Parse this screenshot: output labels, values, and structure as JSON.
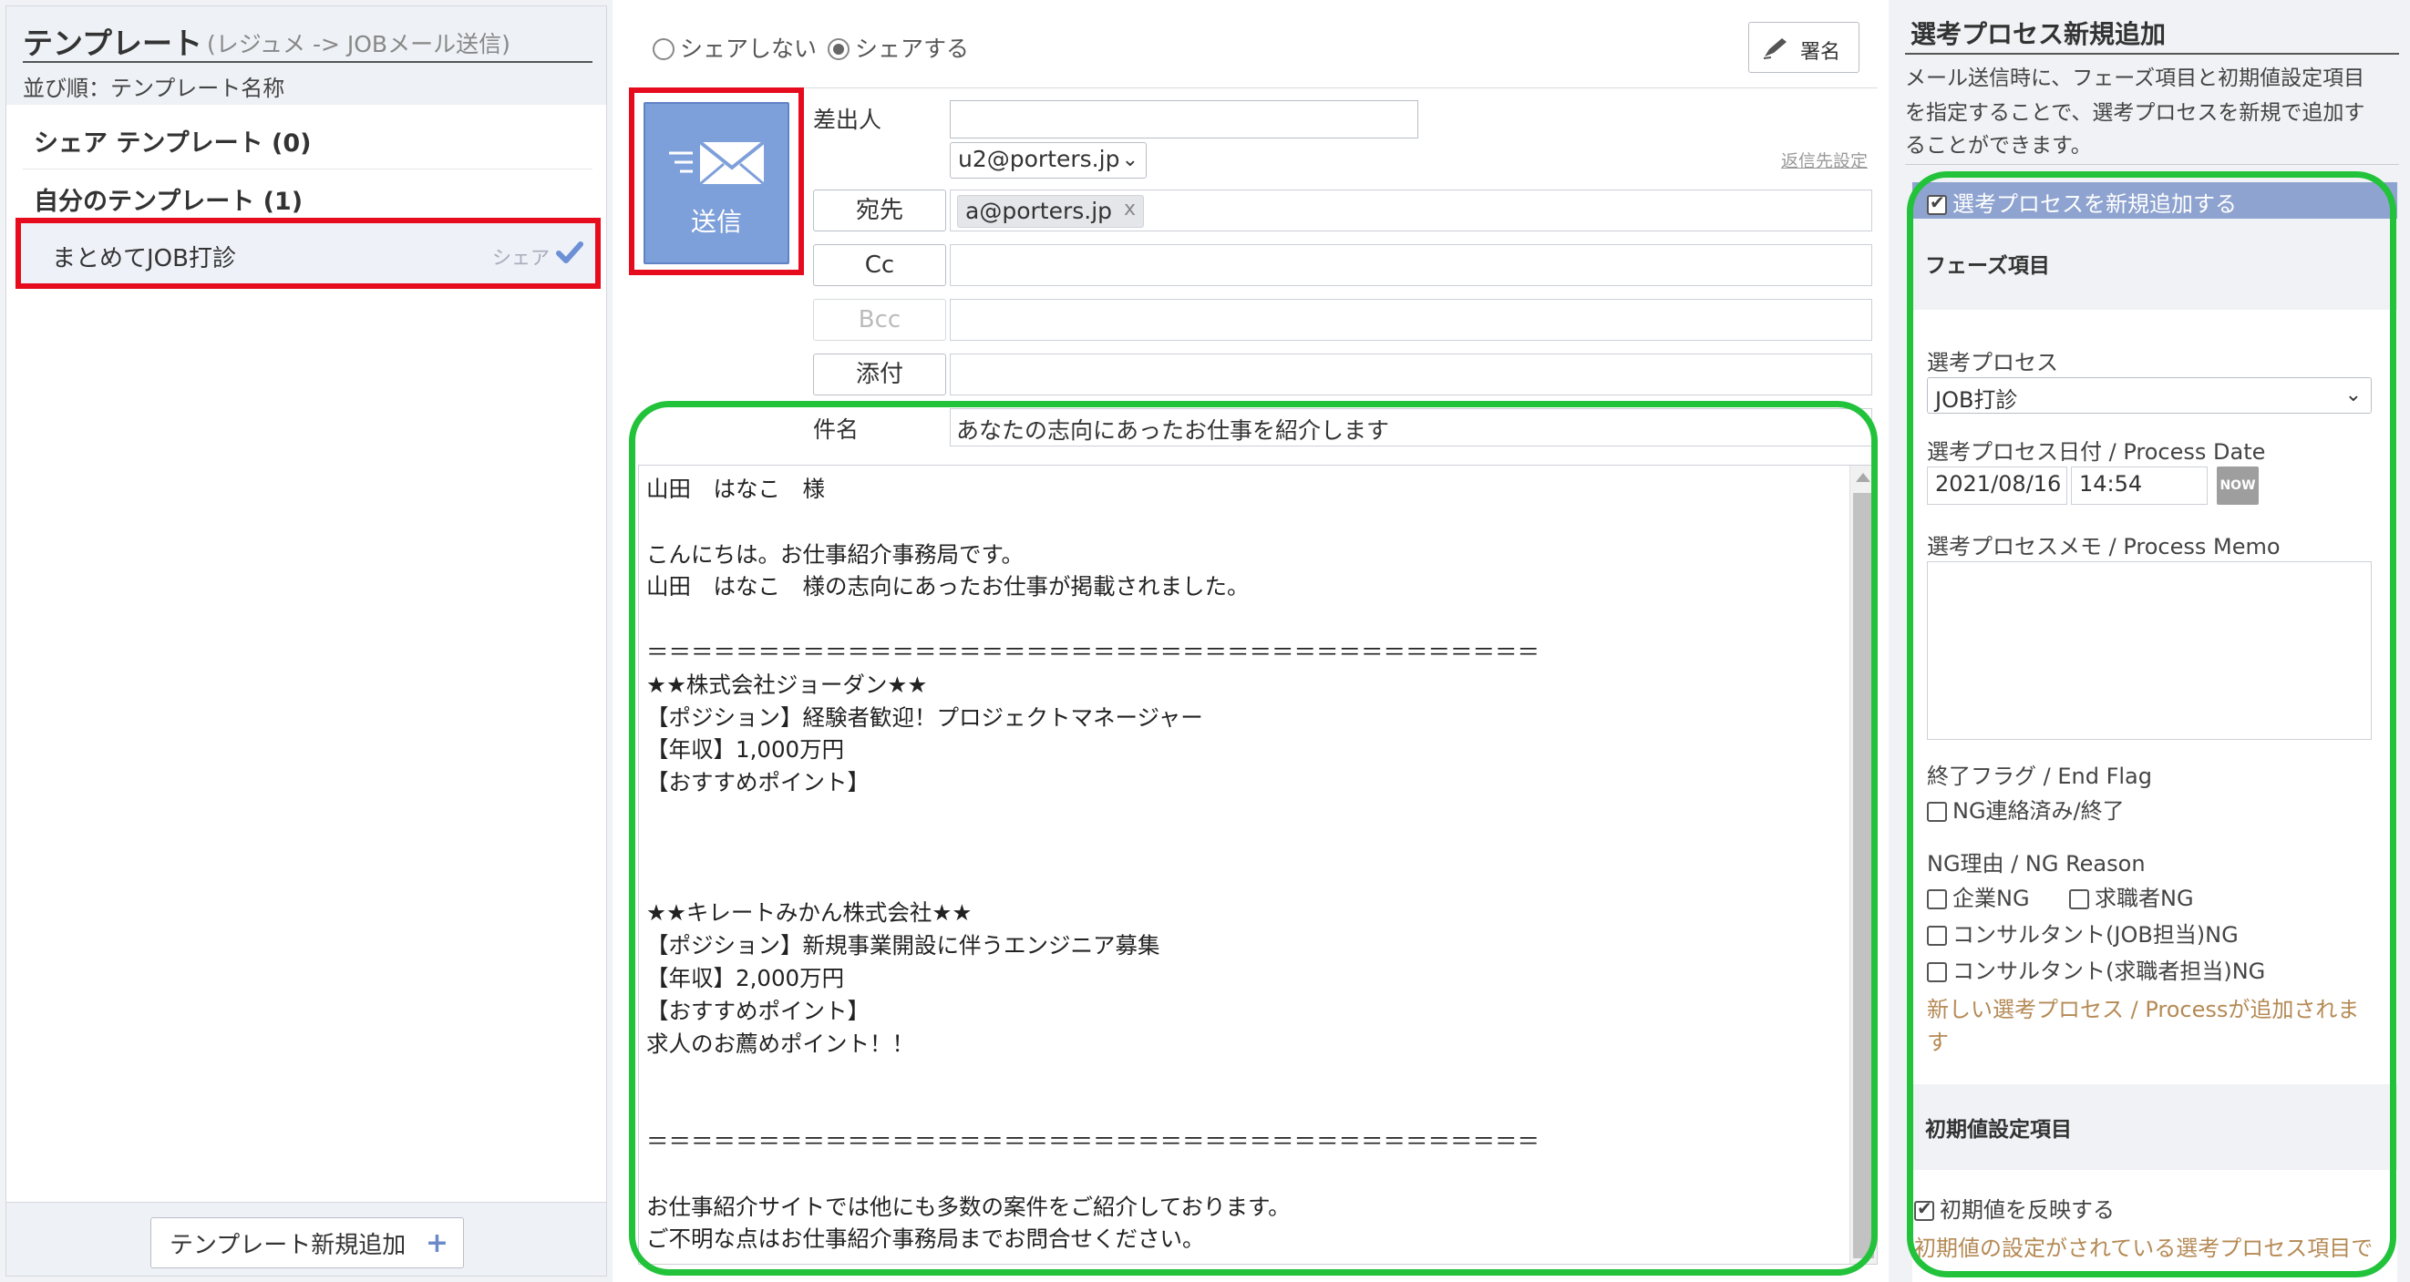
{
  "templates": {
    "title": "テンプレート",
    "subtitle": "(レジュメ -> JOBメール送信)",
    "sort_label": "並び順：テンプレート名称",
    "shared_group": "シェア テンプレート (0)",
    "my_group": "自分のテンプレート (1)",
    "items": [
      {
        "name": "まとめてJOB打診",
        "share_label": "シェア"
      }
    ],
    "add_button": "テンプレート新規追加",
    "add_icon": "+"
  },
  "compose": {
    "share_options": [
      {
        "label": "シェアしない",
        "selected": false
      },
      {
        "label": "シェアする",
        "selected": true
      }
    ],
    "signature_button": "署名",
    "send_button": "送信",
    "from_label": "差出人",
    "from_value": "",
    "from_select": "u2@porters.jp",
    "reply_link": "返信先設定",
    "to_button": "宛先",
    "to_recipient": "a@porters.jp",
    "remove_icon": "x",
    "cc_button": "Cc",
    "bcc_button": "Bcc",
    "attach_button": "添付",
    "subject_label": "件名",
    "subject_value": "あなたの志向にあったお仕事を紹介します",
    "body": "山田　はなこ　様\n\nこんにちは。お仕事紹介事務局です。\n山田　はなこ　様の志向にあったお仕事が掲載されました。\n\n＝＝＝＝＝＝＝＝＝＝＝＝＝＝＝＝＝＝＝＝＝＝＝＝＝＝＝＝＝＝＝＝＝＝＝＝＝＝＝＝\n★★株式会社ジョーダン★★\n【ポジション】経験者歓迎！プロジェクトマネージャー\n【年収】1,000万円\n【おすすめポイント】\n\n\n\n★★キレートみかん株式会社★★\n【ポジション】新規事業開設に伴うエンジニア募集\n【年収】2,000万円\n【おすすめポイント】\n求人のお薦めポイント！！\n\n\n＝＝＝＝＝＝＝＝＝＝＝＝＝＝＝＝＝＝＝＝＝＝＝＝＝＝＝＝＝＝＝＝＝＝＝＝＝＝＝＝\n\nお仕事紹介サイトでは他にも多数の案件をご紹介しております。\nご不明な点はお仕事紹介事務局までお問合せください。"
  },
  "process": {
    "title": "選考プロセス新規追加",
    "desc_lines": [
      "メール送信時に、フェーズ項目と初期値設定項目",
      "を指定することで、選考プロセスを新規で追加す",
      "ることができます。"
    ],
    "add_checkbox": {
      "label": "選考プロセスを新規追加する",
      "checked": true
    },
    "phase_section": "フェーズ項目",
    "process_label": "選考プロセス",
    "process_value": "JOB打診",
    "date_label": "選考プロセス日付 / Process Date",
    "date_value": "2021/08/16",
    "time_value": "14:54",
    "now_button": "NOW",
    "memo_label": "選考プロセスメモ / Process Memo",
    "memo_value": "",
    "end_flag_label": "終了フラグ / End Flag",
    "end_flag_option": {
      "label": "NG連絡済み/終了",
      "checked": false
    },
    "ng_reason_label": "NG理由 / NG Reason",
    "ng_options": [
      {
        "label": "企業NG",
        "checked": false
      },
      {
        "label": "求職者NG",
        "checked": false
      },
      {
        "label": "コンサルタント(JOB担当)NG",
        "checked": false
      },
      {
        "label": "コンサルタント(求職者担当)NG",
        "checked": false
      }
    ],
    "note_lines": [
      "新しい選考プロセス / Processが追加されま",
      "す"
    ],
    "initial_section": "初期値設定項目",
    "initial_checkbox": {
      "label": "初期値を反映する",
      "checked": true
    },
    "initial_note": "初期値の設定がされている選考プロセス項目で"
  },
  "colors": {
    "highlight_red": "#e60b1d",
    "highlight_green": "#22c23b",
    "send_button": "#7d9fda",
    "process_bar": "#8ea3cf",
    "note_text": "#b58a55"
  }
}
